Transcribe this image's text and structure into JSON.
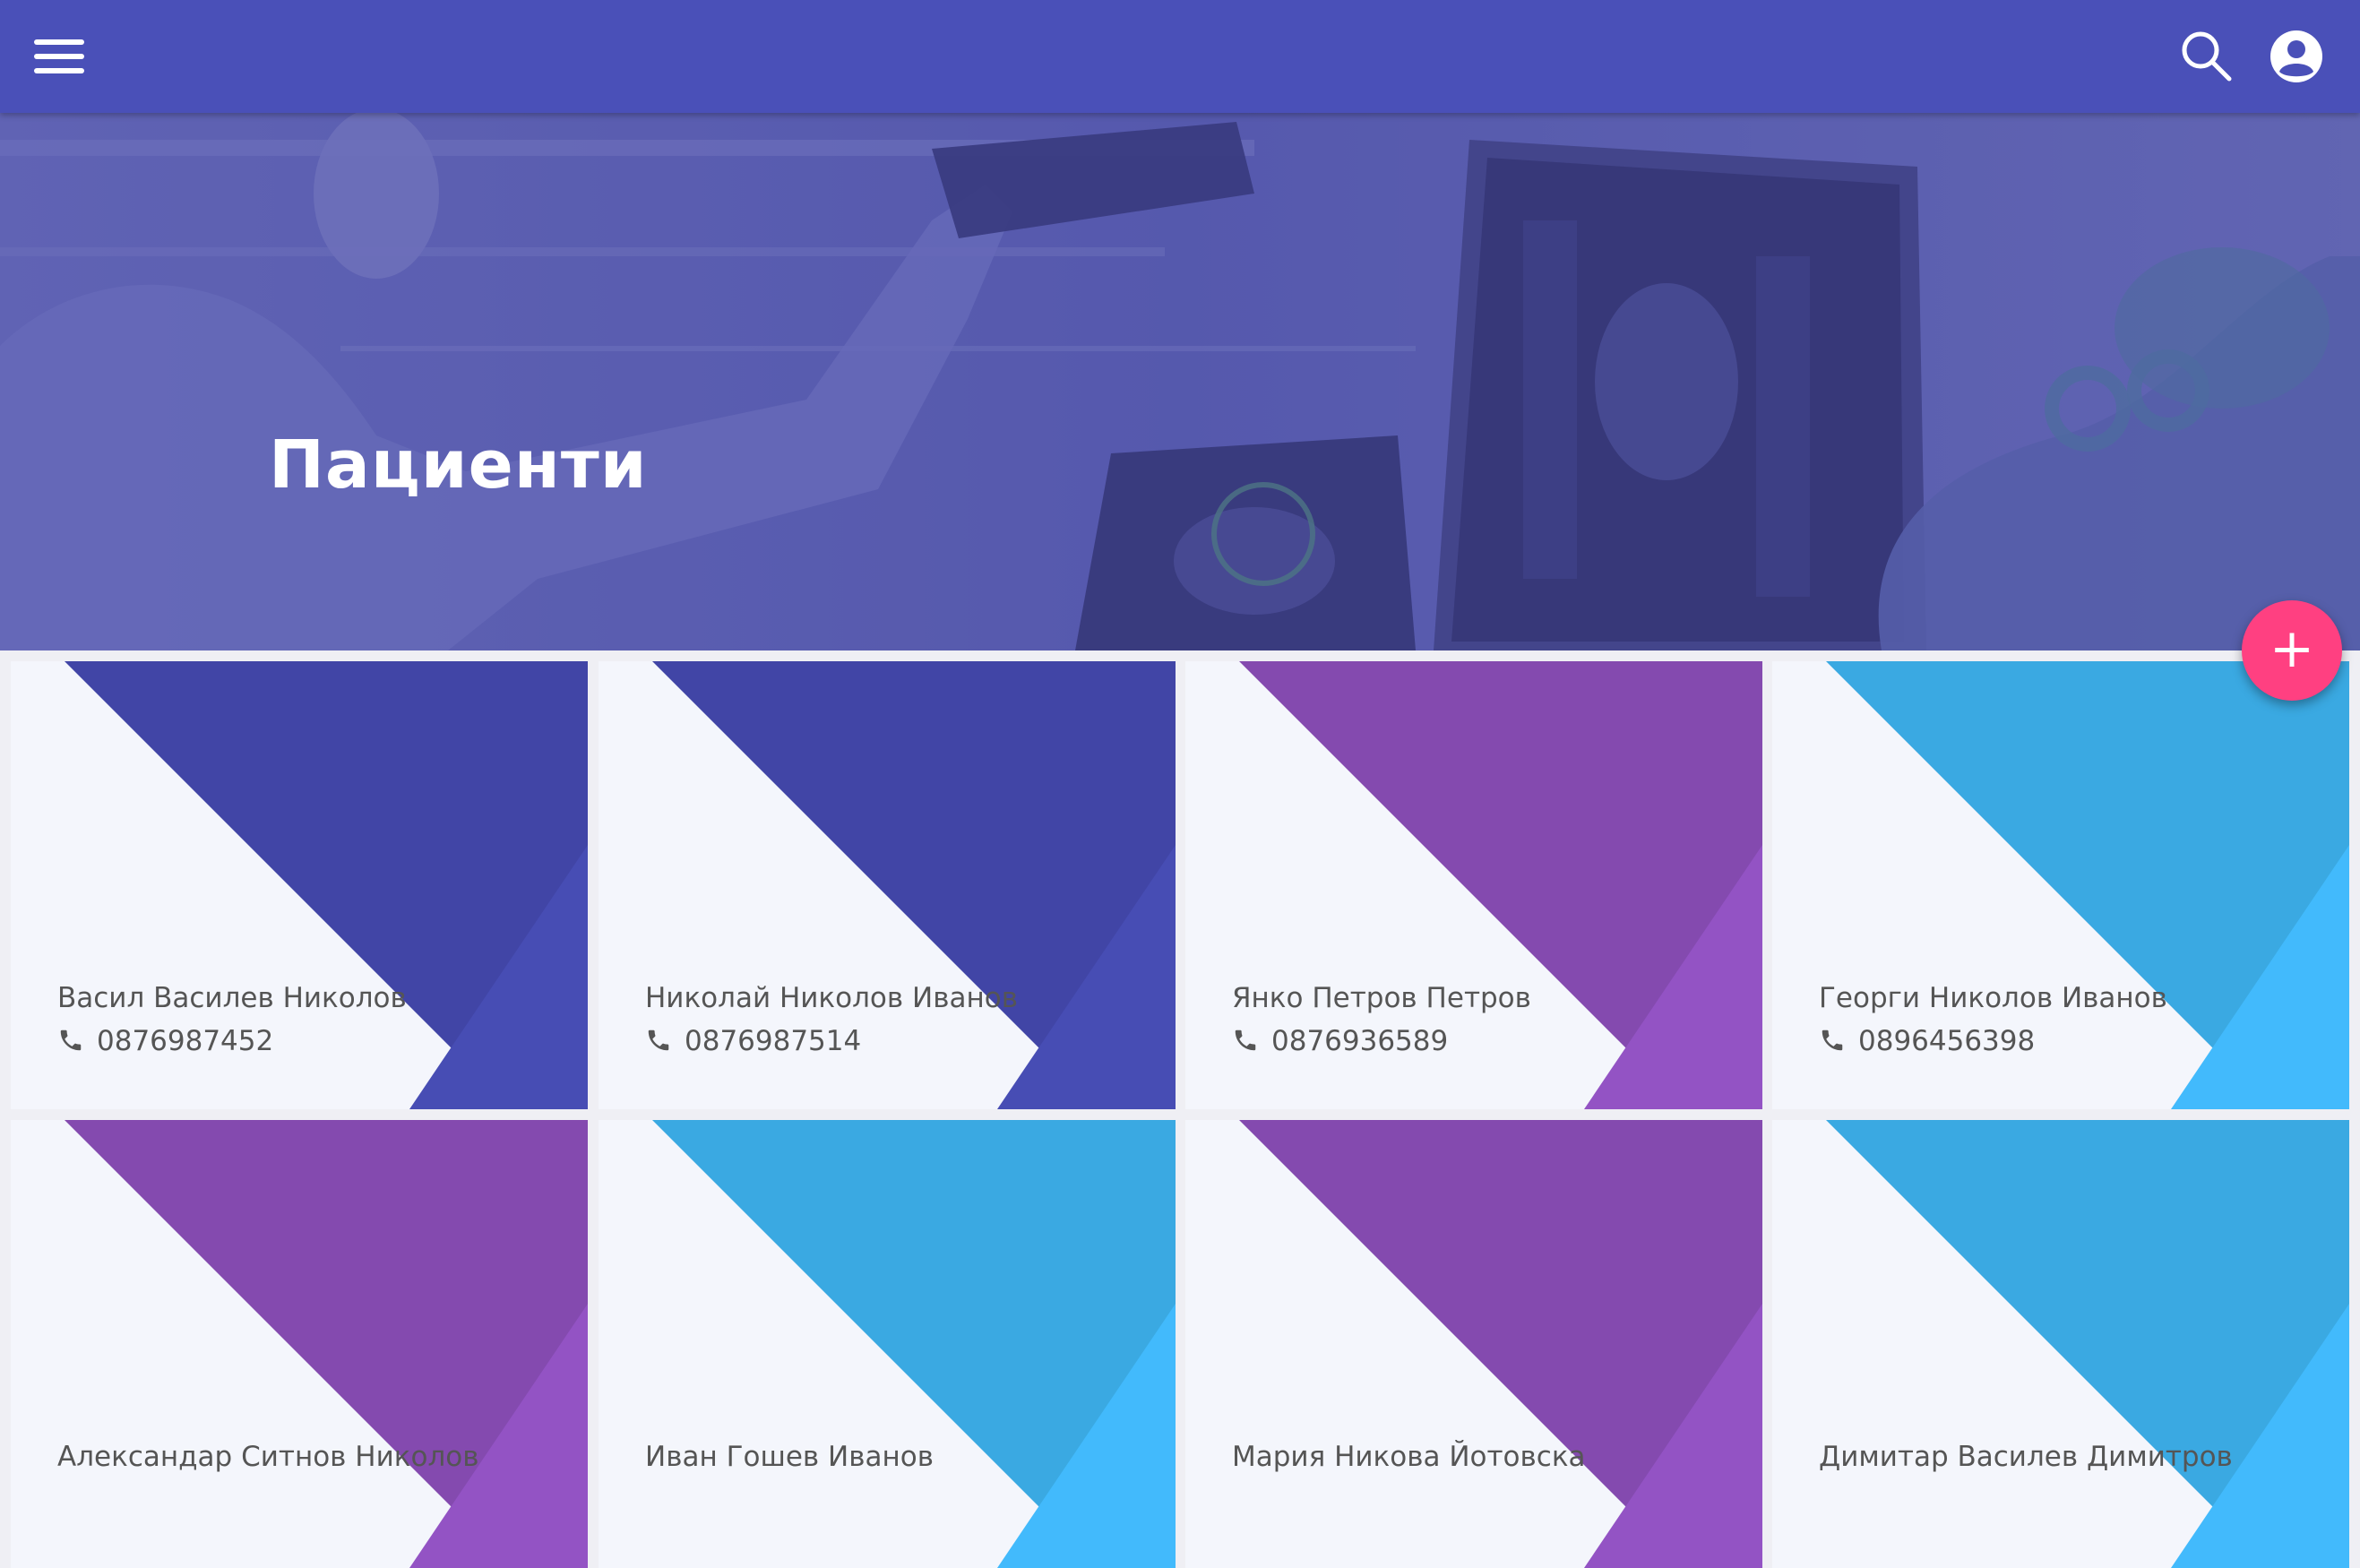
{
  "app": {
    "menu_icon": "menu-icon",
    "search_icon": "search-icon",
    "account_icon": "account-circle-icon",
    "primary_color": "#4a50b8",
    "accent_color": "#ff4081"
  },
  "hero": {
    "title": "Пациенти"
  },
  "fab": {
    "icon": "plus-icon",
    "label": "+"
  },
  "patients": [
    {
      "name": "Васил Василев Николов",
      "phone": "0876987452",
      "theme": "indigo"
    },
    {
      "name": "Николай Николов Иванов",
      "phone": "0876987514",
      "theme": "indigo"
    },
    {
      "name": "Янко Петров Петров",
      "phone": "0876936589",
      "theme": "purple"
    },
    {
      "name": "Георги Николов Иванов",
      "phone": "0896456398",
      "theme": "blue"
    },
    {
      "name": "Александар Ситнов Николов",
      "phone": "",
      "theme": "purple"
    },
    {
      "name": "Иван Гошев Иванов",
      "phone": "",
      "theme": "blue"
    },
    {
      "name": "Мария Никова Йотовска",
      "phone": "",
      "theme": "purple"
    },
    {
      "name": "Димитар Василев Димитров",
      "phone": "",
      "theme": "blue"
    }
  ],
  "themes": {
    "indigo": {
      "main": "#4145a6",
      "accent": "#474db4"
    },
    "purple": {
      "main": "#844aaf",
      "accent": "#9353c4"
    },
    "blue": {
      "main": "#3aa9e2",
      "accent": "#42bafc"
    }
  }
}
